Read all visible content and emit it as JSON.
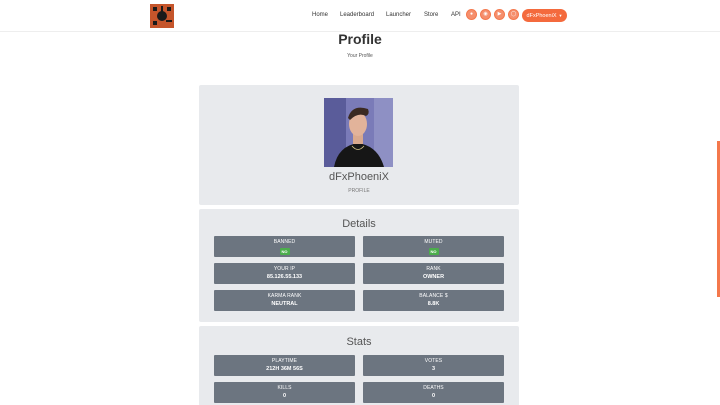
{
  "header": {
    "nav": [
      {
        "label": "Home"
      },
      {
        "label": "Leaderboard"
      },
      {
        "label": "Launcher"
      },
      {
        "label": "Store"
      },
      {
        "label": "API"
      }
    ],
    "social": [
      {
        "icon": "steam-icon"
      },
      {
        "icon": "discord-icon"
      },
      {
        "icon": "youtube-icon"
      },
      {
        "icon": "other-social-icon"
      }
    ],
    "user_label": "dFxPhoeniX",
    "accent": "#f46a3d"
  },
  "page": {
    "title": "Profile",
    "subtitle": "Your Profile"
  },
  "profile": {
    "username": "dFxPhoeniX",
    "label": "PROFILE"
  },
  "details": {
    "title": "Details",
    "items": [
      {
        "label": "BANNED",
        "value": "NO"
      },
      {
        "label": "MUTED",
        "value": "NO"
      },
      {
        "label": "YOUR IP",
        "value": "85.126.55.133"
      },
      {
        "label": "RANK",
        "value": "OWNER"
      },
      {
        "label": "KARMA RANK",
        "value": "NEUTRAL"
      },
      {
        "label": "BALANCE $",
        "value": "8.8K"
      }
    ]
  },
  "stats": {
    "title": "Stats",
    "items": [
      {
        "label": "PLAYTIME",
        "value": "212H 36M 56S"
      },
      {
        "label": "VOTES",
        "value": "3"
      },
      {
        "label": "KILLS",
        "value": "0"
      },
      {
        "label": "DEATHS",
        "value": "0"
      }
    ]
  }
}
